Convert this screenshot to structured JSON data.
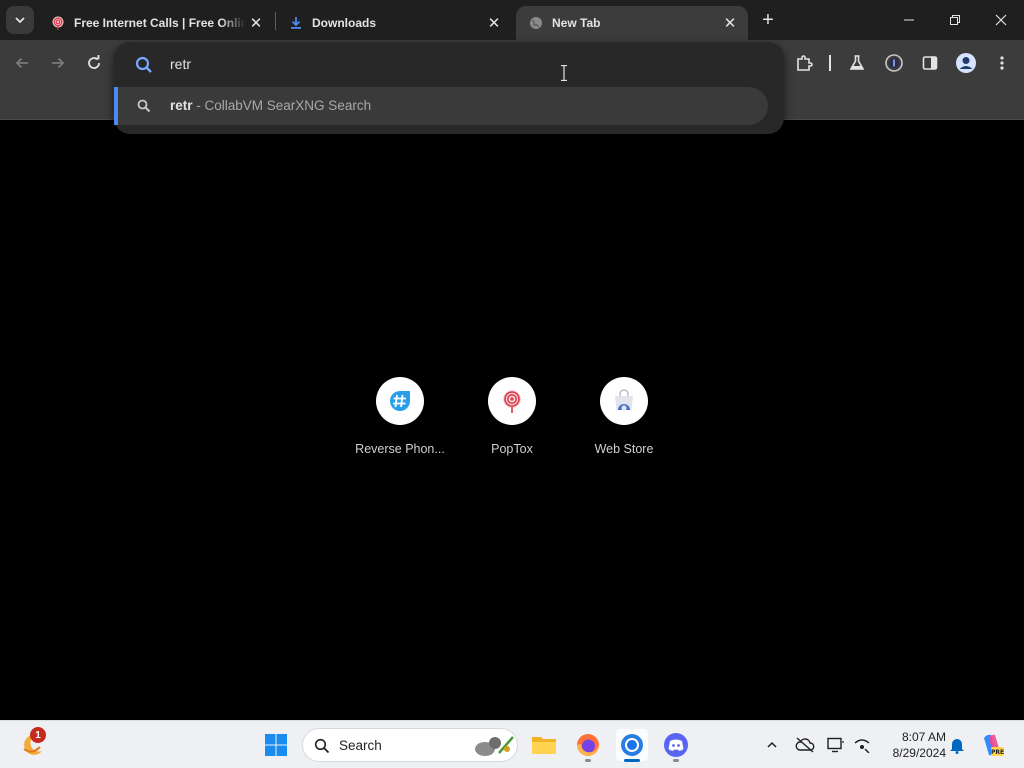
{
  "browser": {
    "tabs": [
      {
        "title": "Free Internet Calls | Free Online",
        "favicon": "poptox-lollipop-icon"
      },
      {
        "title": "Downloads",
        "favicon": "download-icon"
      },
      {
        "title": "New Tab",
        "favicon": "globe-icon",
        "active": true
      }
    ],
    "new_tab_symbol": "+",
    "close_symbol": "✕"
  },
  "omnibox": {
    "value": "retr",
    "suggestion": {
      "query": "retr",
      "separator": " - ",
      "engine": "CollabVM SearXNG Search"
    }
  },
  "shortcuts": [
    {
      "label": "Reverse Phon...",
      "icon": "hashtag-icon"
    },
    {
      "label": "PopTox",
      "icon": "lollipop-icon"
    },
    {
      "label": "Web Store",
      "icon": "web-store-icon"
    }
  ],
  "taskbar": {
    "search_label": "Search",
    "notification_count": "1",
    "time": "8:07 AM",
    "date": "8/29/2024"
  },
  "colors": {
    "accent": "#4d8af0",
    "windows_blue": "#0067c0"
  }
}
